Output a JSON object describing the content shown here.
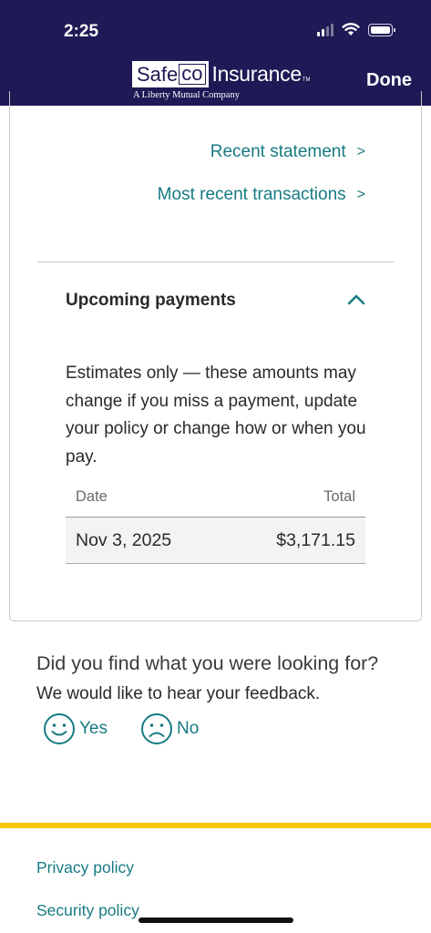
{
  "status_bar": {
    "time": "2:25",
    "icons": [
      "signal-icon",
      "wifi-icon",
      "battery-icon"
    ]
  },
  "header": {
    "logo_safe": "Safe",
    "logo_co": "co",
    "logo_insurance": "Insurance",
    "logo_tm": "TM",
    "logo_tagline": "A Liberty Mutual Company",
    "done_label": "Done",
    "background_color": "#1f1a55"
  },
  "links": {
    "recent_statement": "Recent statement",
    "recent_transactions": "Most recent transactions",
    "chevron": ">"
  },
  "upcoming": {
    "title": "Upcoming payments",
    "expanded": true,
    "note": "Estimates only — these amounts may change if you miss a payment, update your policy or change how or when you pay.",
    "table": {
      "headers": {
        "date": "Date",
        "total": "Total"
      },
      "rows": [
        {
          "date": "Nov 3, 2025",
          "total": "$3,171.15"
        }
      ]
    }
  },
  "feedback": {
    "question": "Did you find what you were looking for?",
    "prompt": "We would like to hear your feedback.",
    "yes_label": "Yes",
    "no_label": "No"
  },
  "footer": {
    "privacy_policy": "Privacy policy",
    "security_policy": "Security policy"
  },
  "colors": {
    "accent": "#177b82",
    "footer_bar": "#f5c800"
  }
}
